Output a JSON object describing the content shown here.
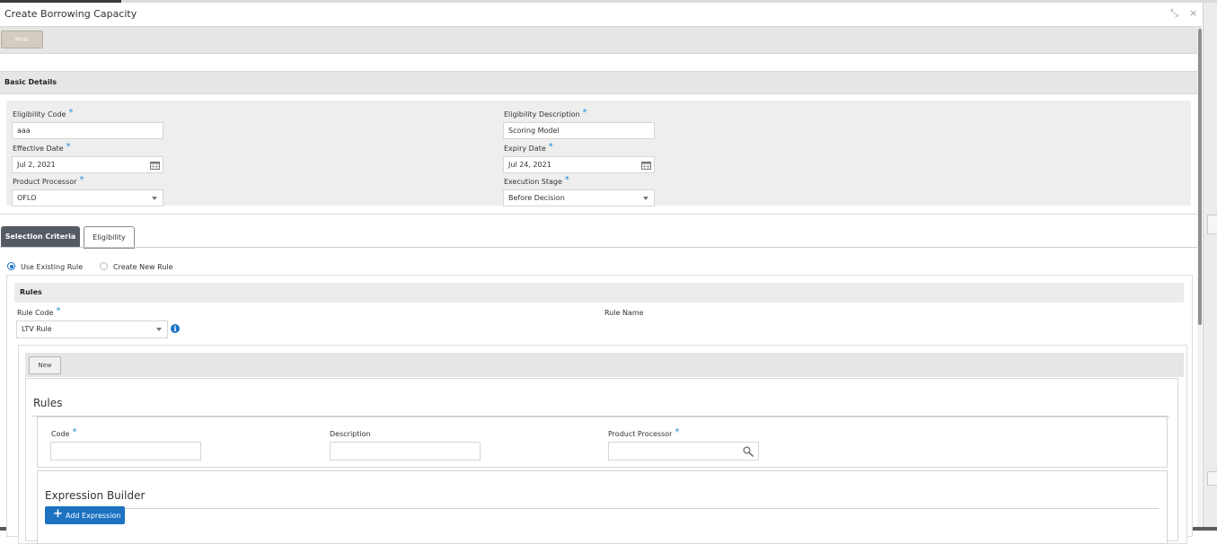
{
  "dialog": {
    "title": "Create Borrowing Capacity",
    "window_controls": {
      "restore": "⤡",
      "close": "×"
    },
    "toolbar": {
      "new_label": "New"
    }
  },
  "basic_details": {
    "heading": "Basic Details",
    "eligibility_code": {
      "label": "Eligibility Code",
      "required": "*",
      "value": "aaa"
    },
    "eligibility_description": {
      "label": "Eligibility Description",
      "required": "*",
      "value": "Scoring Model"
    },
    "effective_date": {
      "label": "Effective Date",
      "required": "*",
      "value": "Jul 2, 2021",
      "icon": "calendar-icon"
    },
    "expiry_date": {
      "label": "Expiry Date",
      "required": "*",
      "value": "Jul 24, 2021",
      "icon": "calendar-icon"
    },
    "product_processor": {
      "label": "Product Processor",
      "required": "*",
      "value": "OFLO"
    },
    "execution_stage": {
      "label": "Execution Stage",
      "required": "*",
      "value": "Before Decision"
    }
  },
  "tabs": [
    {
      "label": "Selection Criteria",
      "active": true
    },
    {
      "label": "Eligibility",
      "active": false
    }
  ],
  "rule_mode": {
    "options": [
      {
        "label": "Use Existing Rule",
        "selected": true
      },
      {
        "label": "Create New Rule",
        "selected": false
      }
    ]
  },
  "rules": {
    "heading": "Rules",
    "rule_code": {
      "label": "Rule Code",
      "required": "*",
      "value": "LTV Rule",
      "info": "i"
    },
    "rule_name": {
      "label": "Rule Name"
    }
  },
  "rule_editor": {
    "new_label": "New",
    "card_title": "Rules",
    "code": {
      "label": "Code",
      "required": "*",
      "value": ""
    },
    "description": {
      "label": "Description",
      "value": ""
    },
    "product_processor": {
      "label": "Product Processor",
      "required": "*",
      "value": "",
      "icon": "search-icon"
    },
    "expression_builder": {
      "title": "Expression Builder",
      "add_label": "Add Expression",
      "add_icon": "+"
    }
  },
  "colors": {
    "accent_blue": "#1d72c2",
    "required_star": "#1a8fd6",
    "active_tab": "#555b63",
    "panel_bg": "#eeeeee"
  }
}
